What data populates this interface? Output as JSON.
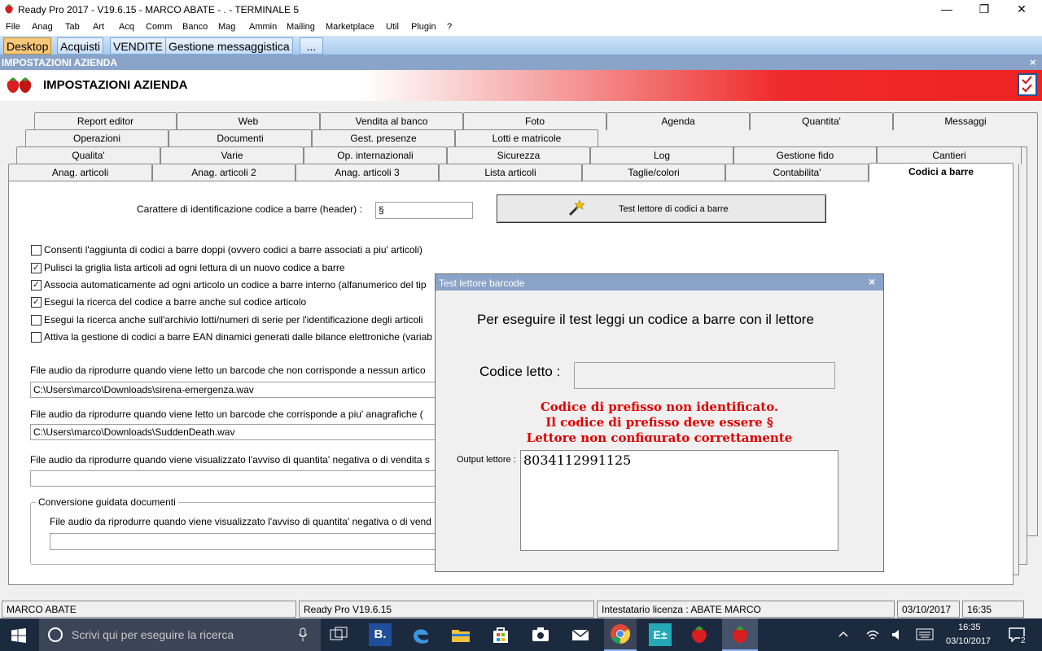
{
  "window": {
    "title": "Ready Pro 2017 - V19.6.15 - MARCO ABATE - . - TERMINALE 5",
    "minimize": "—",
    "maximize": "❐",
    "close": "✕"
  },
  "menu": [
    "File",
    "Anag",
    "Tab",
    "Art",
    "Acq",
    "Comm",
    "Banco",
    "Mag",
    "Ammin",
    "Mailing",
    "Marketplace",
    "Util",
    "Plugin",
    "?"
  ],
  "doc_tabs": [
    "Desktop",
    "Acquisti",
    "VENDITE",
    "Gestione messaggistica",
    "..."
  ],
  "subwindow": {
    "title": "IMPOSTAZIONI AZIENDA",
    "close": "×"
  },
  "header": {
    "title": "IMPOSTAZIONI AZIENDA"
  },
  "tabs": {
    "row1": [
      "Report editor",
      "Web",
      "Vendita al banco",
      "Foto",
      "Agenda",
      "Quantita'",
      "Messaggi"
    ],
    "row2": [
      "Operazioni",
      "Documenti",
      "Gest. presenze",
      "Lotti e matricole"
    ],
    "row3": [
      "Qualita'",
      "Varie",
      "Op. internazionali",
      "Sicurezza",
      "Log",
      "Gestione fido",
      "Cantieri"
    ],
    "row4": [
      "Anag. articoli",
      "Anag. articoli 2",
      "Anag. articoli 3",
      "Lista articoli",
      "Taglie/colori",
      "Contabilita'",
      "Codici a barre"
    ]
  },
  "form": {
    "header_char_label": "Carattere di identificazione codice a barre (header) :",
    "header_char_value": "§",
    "test_button": "Test lettore di codici a barre",
    "checkboxes": [
      {
        "label": "Consenti l'aggiunta di codici a barre doppi (ovvero codici a barre associati a piu' articoli)",
        "checked": false,
        "mark": ""
      },
      {
        "label": "Pulisci la griglia lista articoli ad ogni lettura di un nuovo codice a barre",
        "checked": true,
        "mark": "✓"
      },
      {
        "label": "Associa automaticamente ad ogni articolo un codice a barre interno (alfanumerico del tip",
        "checked": true,
        "mark": "✓"
      },
      {
        "label": "Esegui la ricerca del codice a barre anche sul codice articolo",
        "checked": true,
        "mark": "✓"
      },
      {
        "label": "Esegui la ricerca anche sull'archivio lotti/numeri di serie per l'identificazione degli articoli",
        "checked": false,
        "mark": ""
      },
      {
        "label": "Attiva la gestione di codici a barre EAN dinamici generati dalle bilance elettroniche (variab",
        "checked": false,
        "mark": ""
      }
    ],
    "audio1_label": "File audio da riprodurre quando viene letto un barcode che non corrisponde a nessun artico",
    "audio1_value": "C:\\Users\\marco\\Downloads\\sirena-emergenza.wav",
    "audio2_label": "File audio da riprodurre quando viene letto un barcode che corrisponde a piu' anagrafiche (",
    "audio2_value": "C:\\Users\\marco\\Downloads\\SuddenDeath.wav",
    "audio3_label": "File audio da riprodurre quando viene visualizzato l'avviso di quantita' negativa o di vendita s",
    "audio3_value": "",
    "group_title": "Conversione guidata documenti",
    "audio4_label": "File audio da riprodurre quando viene visualizzato l'avviso di quantita' negativa o di vend",
    "audio4_value": ""
  },
  "dialog": {
    "title": "Test lettore barcode",
    "close": "×",
    "instruction": "Per eseguire il test leggi un codice a barre con il lettore",
    "code_label": "Codice letto :",
    "code_value": "",
    "error_line1": "Codice di prefisso non identificato.",
    "error_line2": "Il codice di prefisso deve essere §",
    "error_line3": "Lettore non configurato correttamente",
    "output_label": "Output lettore :",
    "output_value": "8034112991125"
  },
  "statusbar": {
    "user": "MARCO ABATE",
    "version": "Ready Pro V19.6.15",
    "license": "Intestatario licenza : ABATE MARCO",
    "date": "03/10/2017",
    "time": "16:35"
  },
  "taskbar": {
    "search_placeholder": "Scrivi qui per eseguire la ricerca",
    "clock_time": "16:35",
    "clock_date": "03/10/2017",
    "notifications": "2"
  },
  "colors": {
    "error": "#e00000",
    "tab_active": "#f7c879",
    "title_blue": "#8aa3c8"
  }
}
